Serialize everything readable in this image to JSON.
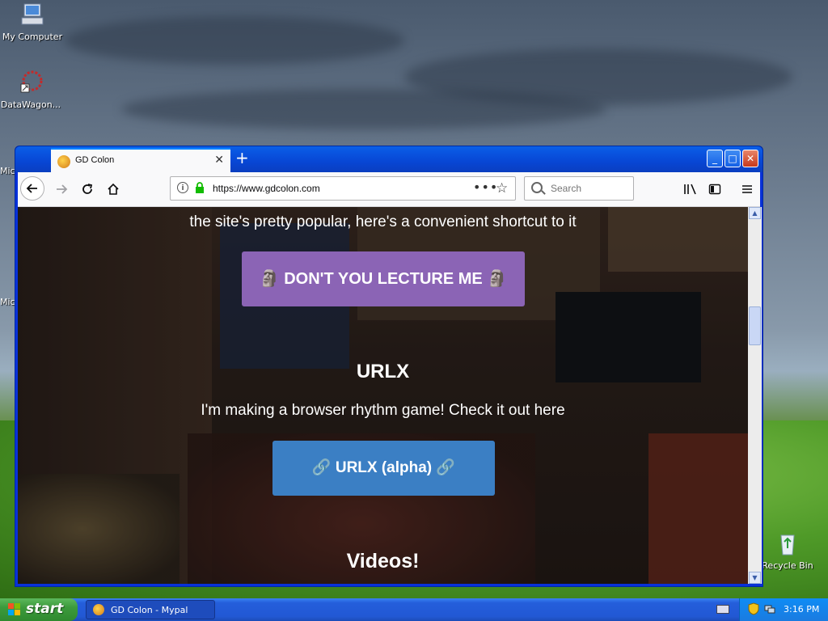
{
  "desktop": {
    "icons": [
      {
        "label": "My Computer",
        "icon": "my-computer-icon"
      },
      {
        "label": "DataWagon...",
        "icon": "datawagon-icon"
      },
      {
        "label": "Recycle Bin",
        "icon": "recycle-bin-icon"
      }
    ],
    "partial_labels": [
      "Mic",
      "Mic"
    ]
  },
  "browser": {
    "tab_title": "GD Colon",
    "new_tab": "+",
    "url": "https://www.gdcolon.com",
    "search_placeholder": "Search"
  },
  "page": {
    "intro_text": "the site's pretty popular, here's a convenient shortcut to it",
    "button1": "🗿 DON'T YOU LECTURE ME 🗿",
    "urlx_heading": "URLX",
    "urlx_desc": "I'm making a browser rhythm game! Check it out here",
    "button2": "🔗 URLX (alpha) 🔗",
    "videos_heading": "Videos!"
  },
  "colors": {
    "button1_bg": "#8b64b5",
    "button2_bg": "#3b7fc4",
    "taskbar": "#245edb",
    "start": "#3c9a3c"
  },
  "taskbar": {
    "start_label": "start",
    "task_label": "GD Colon - Mypal",
    "clock": "3:16 PM"
  }
}
